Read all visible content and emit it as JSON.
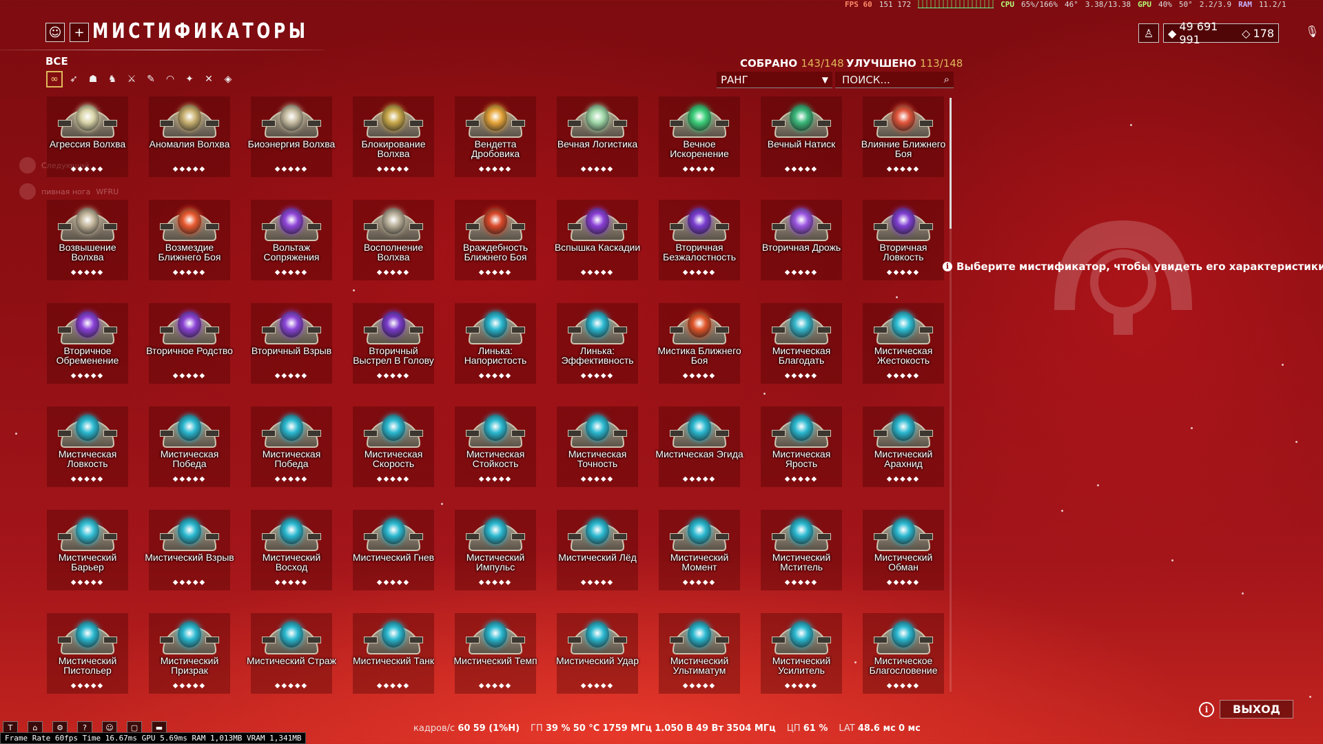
{
  "osd": {
    "fps": "FPS 60",
    "frametime": "151 172",
    "cpu_label": "CPU",
    "cpu": "65%/166%",
    "cpu_temp": "46°",
    "cpu_clock": "3.38/13.38",
    "gpu_label": "GPU",
    "gpu": "40%",
    "gpu_temp": "50°",
    "gpu_clock": "2.2/3.9",
    "ram_label": "RAM",
    "ram": "11.2/1"
  },
  "header": {
    "title": "МИСТИФИКАТОРЫ",
    "category": "ВСЕ",
    "collected_label": "СОБРАНО",
    "collected_value": "143/148",
    "upgraded_label": "УЛУЧШЕНО",
    "upgraded_value": "113/148",
    "sort_value": "РАНГ",
    "search_placeholder": "ПОИСК..."
  },
  "currency": {
    "credits": "49 691 991",
    "platinum": "178"
  },
  "filters": [
    "all-icon",
    "primary-icon",
    "warframe-icon",
    "companion-icon",
    "melee-icon",
    "secondary-icon",
    "archwing-icon",
    "exalted-icon",
    "blades-icon",
    "shotgun-icon"
  ],
  "rank_pips": "◆◆◆◆◆",
  "arcanes": [
    {
      "name": "Агрессия Волхва",
      "color": "#d9d4a8"
    },
    {
      "name": "Аномалия Волхва",
      "color": "#c8b070"
    },
    {
      "name": "Биоэнергия Волхва",
      "color": "#c6bca0"
    },
    {
      "name": "Блокирование Волхва",
      "color": "#c9a84a"
    },
    {
      "name": "Вендетта Дробовика",
      "color": "#e6a53a"
    },
    {
      "name": "Вечная Логистика",
      "color": "#9fd8a8"
    },
    {
      "name": "Вечное Искоренение",
      "color": "#3dd07a"
    },
    {
      "name": "Вечный Натиск",
      "color": "#3bb87a"
    },
    {
      "name": "Влияние Ближнего Боя",
      "color": "#e0553a"
    },
    {
      "name": "Возвышение Волхва",
      "color": "#c2b59a"
    },
    {
      "name": "Возмездие Ближнего Боя",
      "color": "#e85a30"
    },
    {
      "name": "Вольтаж Сопряжения",
      "color": "#8f45d8"
    },
    {
      "name": "Восполнение Волхва",
      "color": "#b8ae98"
    },
    {
      "name": "Враждебность Ближнего Боя",
      "color": "#d9492a"
    },
    {
      "name": "Вспышка Каскадии",
      "color": "#8a3fd6"
    },
    {
      "name": "Вторичная Безжалостность",
      "color": "#7a3dd0"
    },
    {
      "name": "Вторичная Дрожь",
      "color": "#9a55e0"
    },
    {
      "name": "Вторичная Ловкость",
      "color": "#7f3fd2"
    },
    {
      "name": "Вторичное Обременение",
      "color": "#8a40d8"
    },
    {
      "name": "Вторичное Родство",
      "color": "#8b42d5"
    },
    {
      "name": "Вторичный Взрыв",
      "color": "#8a45d8"
    },
    {
      "name": "Вторичный Выстрел В Голову",
      "color": "#7a3bcc"
    },
    {
      "name": "Линька: Напористость",
      "color": "#2ab8d0"
    },
    {
      "name": "Линька: Эффективность",
      "color": "#2ab8d0"
    },
    {
      "name": "Мистика Ближнего Боя",
      "color": "#e0552a"
    },
    {
      "name": "Мистическая Благодать",
      "color": "#35b8cc"
    },
    {
      "name": "Мистическая Жестокость",
      "color": "#2ec0d6"
    },
    {
      "name": "Мистическая Ловкость",
      "color": "#2ab8d0"
    },
    {
      "name": "Мистическая Победа",
      "color": "#2ab8d0"
    },
    {
      "name": "Мистическая Победа",
      "color": "#2ab8d0"
    },
    {
      "name": "Мистическая Скорость",
      "color": "#2ab8d0"
    },
    {
      "name": "Мистическая Стойкость",
      "color": "#2ab8d0"
    },
    {
      "name": "Мистическая Точность",
      "color": "#2ab8d0"
    },
    {
      "name": "Мистическая Эгида",
      "color": "#2ab8d0"
    },
    {
      "name": "Мистическая Ярость",
      "color": "#2ab8d0"
    },
    {
      "name": "Мистический Арахнид",
      "color": "#2ab8d0"
    },
    {
      "name": "Мистический Барьер",
      "color": "#35c0d6"
    },
    {
      "name": "Мистический Взрыв",
      "color": "#2ab8d0"
    },
    {
      "name": "Мистический Восход",
      "color": "#2ab8d0"
    },
    {
      "name": "Мистический Гнев",
      "color": "#2ab8d0"
    },
    {
      "name": "Мистический Импульс",
      "color": "#2ab8d0"
    },
    {
      "name": "Мистический Лёд",
      "color": "#2ab8d0"
    },
    {
      "name": "Мистический Момент",
      "color": "#2ab8d0"
    },
    {
      "name": "Мистический Мститель",
      "color": "#2ab8d0"
    },
    {
      "name": "Мистический Обман",
      "color": "#2ab8d0"
    },
    {
      "name": "Мистический Пистольер",
      "color": "#2ab8d0"
    },
    {
      "name": "Мистический Призрак",
      "color": "#2ab8d0"
    },
    {
      "name": "Мистический Страж",
      "color": "#2ab8d0"
    },
    {
      "name": "Мистический Танк",
      "color": "#2ab8d0"
    },
    {
      "name": "Мистический Темп",
      "color": "#2ab8d0"
    },
    {
      "name": "Мистический Удар",
      "color": "#2ab8d0"
    },
    {
      "name": "Мистический Ультиматум",
      "color": "#2ab8d0"
    },
    {
      "name": "Мистический Усилитель",
      "color": "#2ab8d0"
    },
    {
      "name": "Мистическое Благословение",
      "color": "#2ab8d0"
    }
  ],
  "hint": "Выберите мистификатор, чтобы увидеть его характеристики",
  "exit_label": "ВЫХОД",
  "bottom_stats": {
    "fps_label": "кадров/с",
    "fps": "60",
    "low": "59 (1%Н)",
    "gpu_label": "ГП",
    "gpu_load": "39 %",
    "gpu_temp": "50 °C",
    "gpu_clock": "1759 МГц",
    "gpu_volt": "1.050 В",
    "gpu_power": "49 Вт",
    "mem_clock": "3504 МГц",
    "cpu_label": "ЦП",
    "cpu_load": "61 %",
    "lat_label": "LAT",
    "lat": "48.6 мс",
    "lat2": "0 мс"
  },
  "frame_bar": "Frame Rate 60fps Time 16.67ms GPU 5.69ms RAM 1,013MB VRAM 1,341MB",
  "ghost_chat": [
    "Следующий...",
    "пивная нога",
    "WFRU"
  ]
}
